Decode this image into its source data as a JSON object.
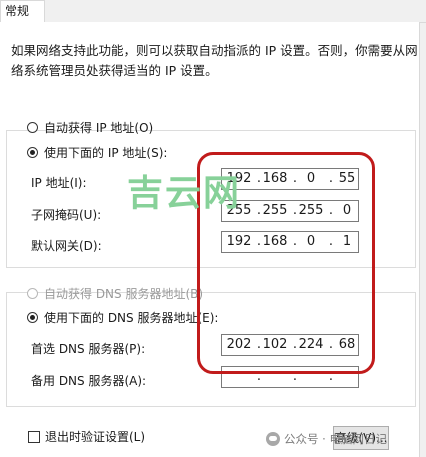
{
  "tabs": {
    "general": "常规"
  },
  "intro": {
    "line1": "如果网络支持此功能，则可以获取自动指派的 IP 设置。否则，你需要从网",
    "line2": "络系统管理员处获得适当的 IP 设置。"
  },
  "ip_section": {
    "auto_option": "自动获得 IP 地址(O)",
    "manual_option": "使用下面的 IP 地址(S):",
    "ip_label": "IP 地址(I):",
    "ip_value": [
      "192",
      "168",
      "0",
      "55"
    ],
    "mask_label": "子网掩码(U):",
    "mask_value": [
      "255",
      "255",
      "255",
      "0"
    ],
    "gateway_label": "默认网关(D):",
    "gateway_value": [
      "192",
      "168",
      "0",
      "1"
    ]
  },
  "dns_section": {
    "auto_option": "自动获得 DNS 服务器地址(B)",
    "manual_option": "使用下面的 DNS 服务器地址(E):",
    "preferred_label": "首选 DNS 服务器(P):",
    "preferred_value": [
      "202",
      "102",
      "224",
      "68"
    ],
    "alternate_label": "备用 DNS 服务器(A):",
    "alternate_value": [
      "",
      "",
      "",
      ""
    ]
  },
  "footer": {
    "validate_label": "退出时验证设置(L)",
    "advanced_button": "高级(V)..."
  },
  "watermark": {
    "brand": "吉云网",
    "credit": "公众号 · 电脑网日记"
  },
  "colors": {
    "highlight": "#c11b1b",
    "watermark": "#87d199"
  }
}
